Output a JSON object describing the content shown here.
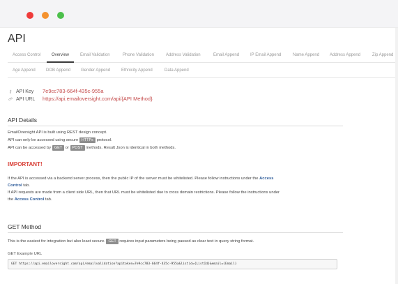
{
  "window": {
    "colors": {
      "close": "#ef3b3a",
      "minimize": "#f4922f",
      "maximize": "#4cc04b"
    }
  },
  "page": {
    "title": "API"
  },
  "tabs": {
    "row1": [
      "Access Control",
      "Overview",
      "Email Validation",
      "Phone Validation",
      "Address Validation",
      "Email Append",
      "IP Email Append",
      "Name Append",
      "Address Append",
      "Zip Append"
    ],
    "row2": [
      "Age Append",
      "DOB Append",
      "Gender Append",
      "Ethnicity Append",
      "Data Append"
    ],
    "active": "Overview"
  },
  "api": {
    "key_label": "API Key",
    "key_value": "7e9cc783-664f-435c-955a",
    "key_icon": "key-icon",
    "url_label": "API URL",
    "url_value": "https://api.emailoversight.com/api/{API Method}",
    "url_icon": "link-icon"
  },
  "details": {
    "title": "API Details",
    "line1": "EmailOversight API is built using REST design concept.",
    "line2_pre": "API can only be accessed using secure",
    "line2_badge": "HTTPs",
    "line2_post": "protocol.",
    "line3_pre": "API can be accessed by",
    "line3_badge1": "GET",
    "line3_mid": "or",
    "line3_badge2": "POST",
    "line3_post": "methods. Result Json is identical in both methods."
  },
  "important": {
    "title": "IMPORTANT!",
    "p1_pre": "If the API is accessed via a backend server process, then the public IP of the server must be whitelisted. Please follow instructions under the",
    "p1_link": "Access",
    "p1_link2": "Control",
    "p1_post": "tab.",
    "p2_pre": "If API requests are made from a client side URL, then that URL must be whitelisted due to cross domain restrictions. Please follow the instructions under",
    "p2_mid": "the",
    "p2_link": "Access Control",
    "p2_post": "tab."
  },
  "get_method": {
    "title": "GET Method",
    "desc_pre": "This is the easiest for integration but also least secure.",
    "desc_badge": "GET",
    "desc_post": "requires input parameters being passed as clear text in query string format.",
    "example_label": "GET Example URL",
    "example_url": "GET https://api.emailoversight.com/api/emailvalidation?apitoken=7e9cc783-664f-435c-955a&listid={ListId}&email={Email}"
  }
}
